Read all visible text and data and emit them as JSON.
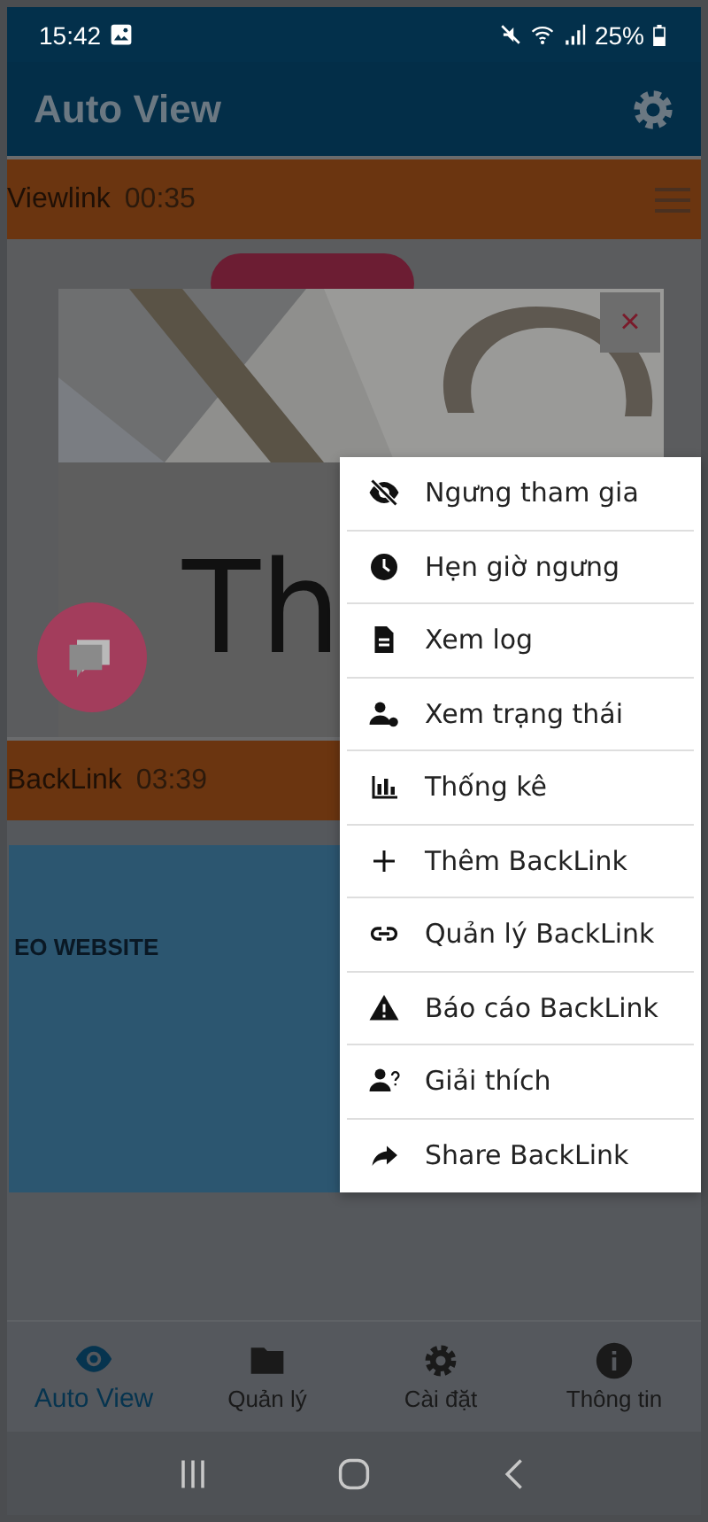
{
  "status_bar": {
    "time": "15:42",
    "battery": "25%"
  },
  "app_bar": {
    "title": "Auto View"
  },
  "sections": [
    {
      "title": "Viewlink",
      "timer": "00:35"
    },
    {
      "title": "BackLink",
      "timer": "03:39"
    }
  ],
  "ad": {
    "headline": "Th",
    "close": "×"
  },
  "banner": {
    "heading": "EO WEBSITE"
  },
  "menu": {
    "items": [
      {
        "label": "Ngưng tham gia"
      },
      {
        "label": "Hẹn giờ ngưng"
      },
      {
        "label": "Xem log"
      },
      {
        "label": "Xem trạng thái"
      },
      {
        "label": "Thống kê"
      },
      {
        "label": "Thêm BackLink"
      },
      {
        "label": "Quản lý BackLink"
      },
      {
        "label": "Báo cáo BackLink"
      },
      {
        "label": "Giải thích"
      },
      {
        "label": "Share BackLink"
      }
    ]
  },
  "bottom_nav": [
    {
      "label": "Auto View",
      "selected": true
    },
    {
      "label": "Quản lý",
      "selected": false
    },
    {
      "label": "Cài đặt",
      "selected": false
    },
    {
      "label": "Thông tin",
      "selected": false
    }
  ]
}
